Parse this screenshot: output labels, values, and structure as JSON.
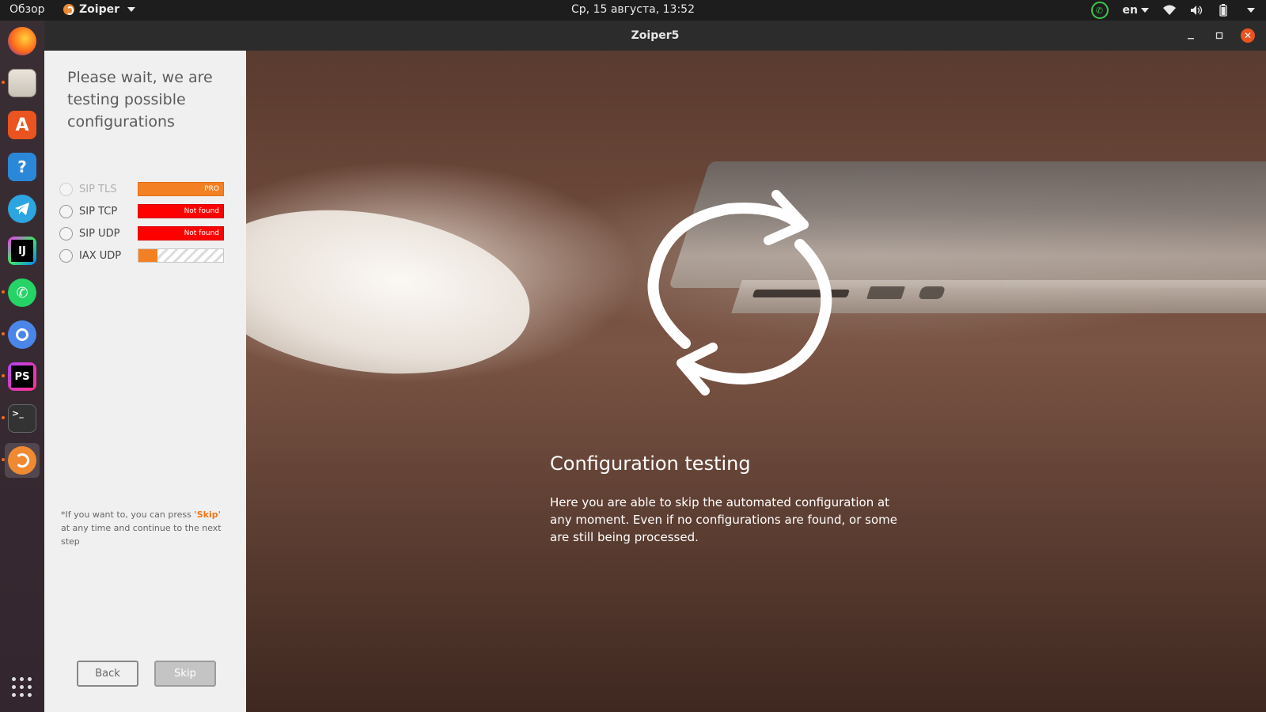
{
  "topbar": {
    "activities": "Обзор",
    "app_name": "Zoiper",
    "clock": "Ср, 15 августа, 13:52",
    "language": "en"
  },
  "dock": {
    "items": [
      {
        "name": "firefox",
        "color": "#ff6a1a"
      },
      {
        "name": "files",
        "color": "#d8d2c8"
      },
      {
        "name": "software",
        "color": "#e95420"
      },
      {
        "name": "help",
        "color": "#2b87d8"
      },
      {
        "name": "telegram",
        "color": "#2ca5e0"
      },
      {
        "name": "intellij",
        "color": "#111111"
      },
      {
        "name": "whatsapp",
        "color": "#25d366"
      },
      {
        "name": "chromium",
        "color": "#4a86e8"
      },
      {
        "name": "phpstorm",
        "color": "#8a2be2"
      },
      {
        "name": "terminal",
        "color": "#333333"
      },
      {
        "name": "zoiper",
        "color": "#f08a32"
      }
    ],
    "labels": {
      "intellij": "IJ",
      "phpstorm": "PS",
      "terminal": ">_",
      "help": "?"
    }
  },
  "window": {
    "title": "Zoiper5"
  },
  "sidebar": {
    "heading": "Please wait, we are testing possible configurations",
    "configs": [
      {
        "label": "SIP TLS",
        "status": "PRO",
        "state": "pro"
      },
      {
        "label": "SIP TCP",
        "status": "Not found",
        "state": "not_found"
      },
      {
        "label": "SIP UDP",
        "status": "Not found",
        "state": "not_found"
      },
      {
        "label": "IAX UDP",
        "status": "",
        "state": "in_progress",
        "progress": 0.22
      }
    ],
    "note_prefix": "*If you want to, you can press ",
    "note_skip": "'Skip'",
    "note_suffix": " at any time and continue to the next step",
    "back_label": "Back",
    "skip_label": "Skip"
  },
  "main": {
    "title": "Configuration testing",
    "description": "Here you are able to skip the automated configuration at any moment. Even if no configurations are found, or some are still being processed."
  },
  "colors": {
    "accent": "#f48024",
    "not_found": "#ff0000",
    "close": "#e95420"
  }
}
